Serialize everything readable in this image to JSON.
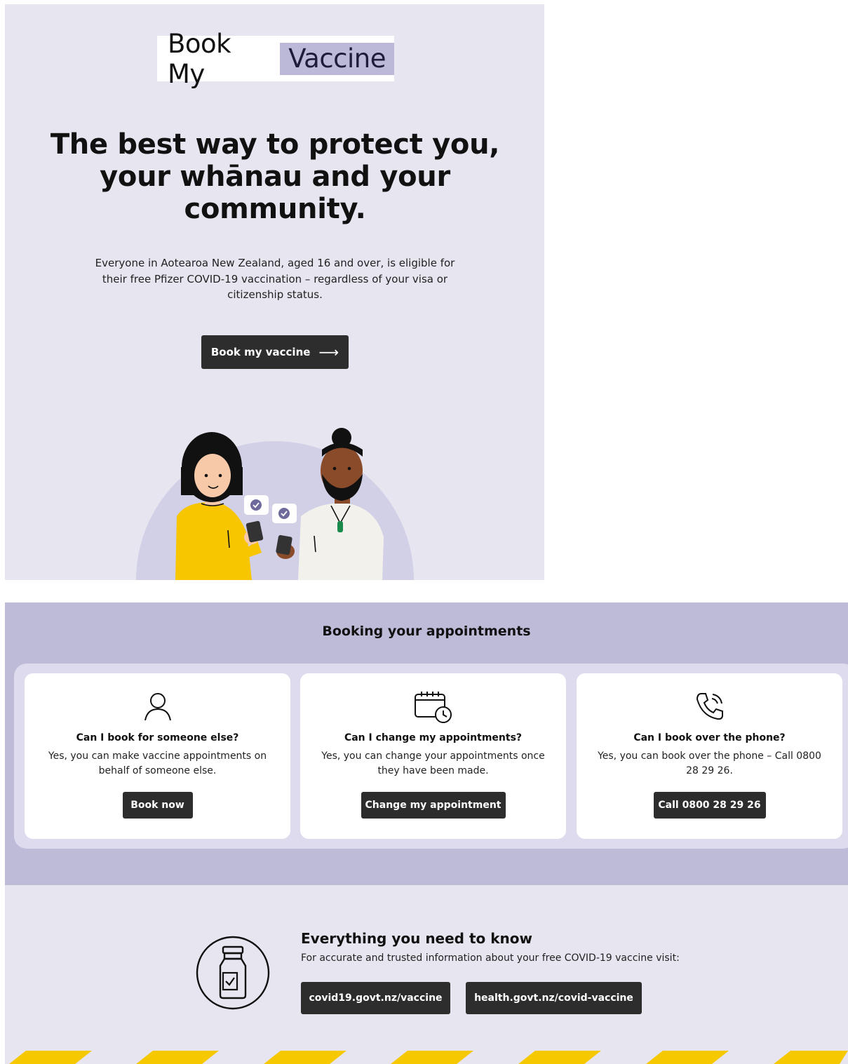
{
  "logo": {
    "part1": "Book My",
    "part2": "Vaccine"
  },
  "hero": {
    "title": "The best way to protect you, your whānau and your community.",
    "description": "Everyone in Aotearoa New Zealand, aged 16 and over, is eligible for their free Pfizer COVID-19 vaccination – regardless of your visa or citizenship status.",
    "button_label": "Book my vaccine",
    "button_arrow": "⟶"
  },
  "booking": {
    "title": "Booking your appointments",
    "cards": [
      {
        "icon": "person-icon",
        "question": "Can I book for someone else?",
        "answer": "Yes, you can make vaccine appointments on behalf of someone else.",
        "button": "Book now"
      },
      {
        "icon": "calendar-clock-icon",
        "question": "Can I change my appointments?",
        "answer": "Yes, you can change your appointments once they have been made.",
        "button": "Change my appointment"
      },
      {
        "icon": "phone-icon",
        "question": "Can I book over the phone?",
        "answer": "Yes, you can book over the phone – Call 0800 28 29 26.",
        "button": "Call 0800 28 29 26"
      }
    ]
  },
  "know": {
    "icon": "vaccine-vial-icon",
    "title": "Everything you need to know",
    "description": "For accurate and trusted information about your free COVID-19 vaccine visit:",
    "links": [
      {
        "label": "covid19.govt.nz/vaccine"
      },
      {
        "label": "health.govt.nz/covid-vaccine"
      }
    ]
  },
  "colors": {
    "hero_bg": "#e7e5f0",
    "booking_bg": "#bebbd9",
    "button_bg": "#2d2d2d",
    "accent_yellow": "#f5c800"
  }
}
